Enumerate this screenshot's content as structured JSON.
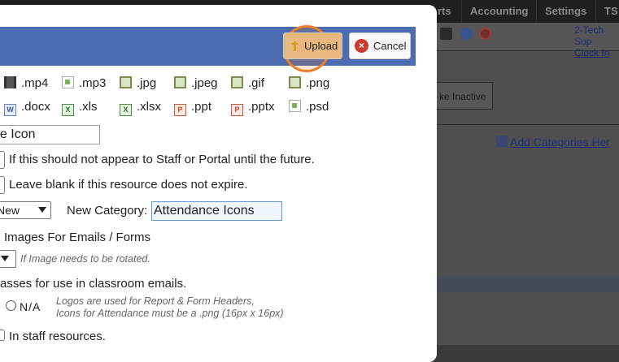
{
  "nav": {
    "items": [
      "rts",
      "Accounting",
      "Settings",
      "TS"
    ]
  },
  "user": {
    "name": "2-Tech Sup",
    "clock_in": "Clock In"
  },
  "background": {
    "make_inactive": "ke Inactive",
    "add_categories": "Add Categories Her"
  },
  "modal": {
    "upload_label": "Upload",
    "cancel_label": "Cancel",
    "file_types_row1": [
      ".mp4",
      ".mp3",
      ".jpg",
      ".jpeg",
      ".gif",
      ".png"
    ],
    "file_types_row2": [
      ".docx",
      ".xls",
      ".xlsx",
      ".ppt",
      ".pptx",
      ".psd"
    ],
    "name_value": "nce Icon",
    "future_note": "If this should not appear to Staff or Portal until the future.",
    "expire_note": "Leave blank if this resource does not expire.",
    "category_select": "New",
    "new_category_label": "New Category:",
    "new_category_value": "Attendance Icons",
    "images_for_emails": "Images For Emails / Forms",
    "rotate_note": "If Image needs to be rotated.",
    "classes_text": "asses for use in classroom emails.",
    "na_label": "N/A",
    "logos_note_1": "Logos are used for Report & Form Headers,",
    "logos_note_2": "Icons for Attendance must be a .png (16px x 16px)",
    "staff_resources": "In staff resources."
  }
}
